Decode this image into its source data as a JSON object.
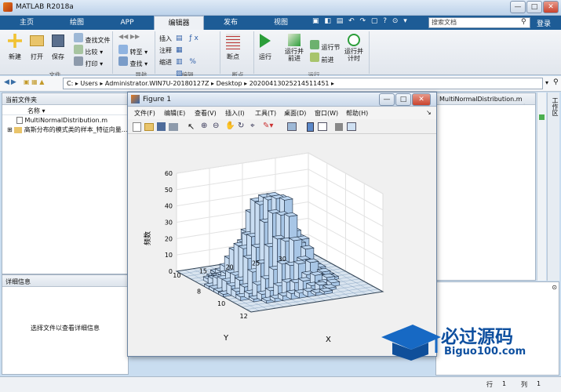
{
  "app": {
    "title": "MATLAB R2018a"
  },
  "tabs": [
    "主页",
    "绘图",
    "APP",
    "编辑器",
    "发布",
    "视图"
  ],
  "search": {
    "placeholder": "搜索文档",
    "login": "登录"
  },
  "ribbon": {
    "file": {
      "new": "新建",
      "open": "打开",
      "save": "保存",
      "find_files": "查找文件",
      "compare": "比较",
      "print": "打印",
      "section": "文件"
    },
    "nav": {
      "goto": "转至",
      "find": "查找",
      "section": "导航"
    },
    "edit": {
      "insert": "插入",
      "comment": "注释",
      "indent": "缩进",
      "section": "编辑"
    },
    "breakpoints": {
      "label": "断点",
      "section": "断点"
    },
    "run": {
      "run": "运行",
      "run_advance": "运行并\n前进",
      "run_section": "运行节",
      "advance": "前进",
      "run_time": "运行并\n计时",
      "section": "运行"
    }
  },
  "address": {
    "path": "C: ▸ Users ▸ Administrator.WIN7U-20180127Z ▸ Desktop ▸ 20200413025214511451 ▸"
  },
  "filebrowser": {
    "title": "当前文件夹",
    "col_name": "名称 ▾",
    "items": [
      "MultiNormalDistribution.m",
      "高斯分布的模式类的样本_特征向量..."
    ]
  },
  "details": {
    "title": "详细信息",
    "message": "选择文件以查看详细信息"
  },
  "editor": {
    "tab": "MultiNormalDistribution.m"
  },
  "workspace": {
    "label": "工作区"
  },
  "figure": {
    "title": "Figure 1",
    "menu": [
      "文件(F)",
      "编辑(E)",
      "查看(V)",
      "插入(I)",
      "工具(T)",
      "桌面(D)",
      "窗口(W)",
      "帮助(H)"
    ]
  },
  "chart_data": {
    "type": "3d-bar-histogram",
    "title": "",
    "xlabel": "X",
    "ylabel": "Y",
    "zlabel": "频数",
    "x_ticks": [
      "8",
      "10",
      "12"
    ],
    "y_ticks": [
      "10",
      "15",
      "20",
      "25",
      "30"
    ],
    "z_ticks": [
      "0",
      "10",
      "20",
      "30",
      "40",
      "50",
      "60"
    ],
    "zlim": [
      0,
      60
    ],
    "peak_value": 53,
    "bar_color": "#b9d3ee"
  },
  "status": {
    "row_label": "行",
    "row": "1",
    "col_label": "列",
    "col": "1"
  },
  "watermark": {
    "text": "必过源码",
    "url": "Biguo100.com"
  }
}
